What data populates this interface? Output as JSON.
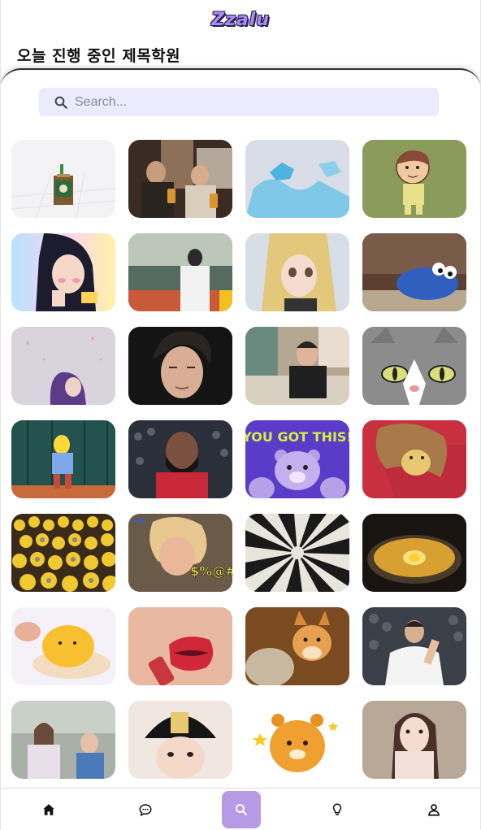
{
  "app": {
    "logo": "Zzalu"
  },
  "header": {
    "title": "오늘 진행 중인 제목학원"
  },
  "search": {
    "placeholder": "Search..."
  },
  "gifs": [
    {
      "name": "gif-tile-minecraft-cup"
    },
    {
      "name": "gif-tile-men-with-beer"
    },
    {
      "name": "gif-tile-blue-clouds"
    },
    {
      "name": "gif-tile-cartoon-kid"
    },
    {
      "name": "gif-tile-anime-woman-blush"
    },
    {
      "name": "gif-tile-basketball-crowd"
    },
    {
      "name": "gif-tile-anime-blonde-girl"
    },
    {
      "name": "gif-tile-cookie-monster"
    },
    {
      "name": "gif-tile-girl-petals"
    },
    {
      "name": "gif-tile-young-man-portrait"
    },
    {
      "name": "gif-tile-man-on-couch"
    },
    {
      "name": "gif-tile-cartoon-cat"
    },
    {
      "name": "gif-tile-simpsons-ralph"
    },
    {
      "name": "gif-tile-bearded-player"
    },
    {
      "name": "gif-tile-you-got-this-bear"
    },
    {
      "name": "gif-tile-wig-dog"
    },
    {
      "name": "gif-tile-minions-crowd"
    },
    {
      "name": "gif-tile-angry-kid-symbols"
    },
    {
      "name": "gif-tile-optical-illusion"
    },
    {
      "name": "gif-tile-egg-soup"
    },
    {
      "name": "gif-tile-squishy-toy"
    },
    {
      "name": "gif-tile-lips-lipstick"
    },
    {
      "name": "gif-tile-shiba-dog"
    },
    {
      "name": "gif-tile-football-player"
    },
    {
      "name": "gif-tile-tv-show-women"
    },
    {
      "name": "gif-tile-girl-in-cap"
    },
    {
      "name": "gif-tile-kakao-ryan"
    },
    {
      "name": "gif-tile-girl-eating"
    }
  ],
  "gif_text": {
    "you_got_this": "YOU GOT THIS!",
    "symbols": "$%@#"
  },
  "tabbar": {
    "tabs": [
      {
        "name": "tab-home",
        "icon": "home-icon",
        "active": false
      },
      {
        "name": "tab-chat",
        "icon": "chat-icon",
        "active": false
      },
      {
        "name": "tab-search",
        "icon": "search-icon",
        "active": true
      },
      {
        "name": "tab-ideas",
        "icon": "lightbulb-icon",
        "active": false
      },
      {
        "name": "tab-profile",
        "icon": "user-icon",
        "active": false
      }
    ]
  },
  "colors": {
    "accent": "#b69ae6",
    "search_bg": "#eceafd",
    "logo": "#a78bfa"
  }
}
